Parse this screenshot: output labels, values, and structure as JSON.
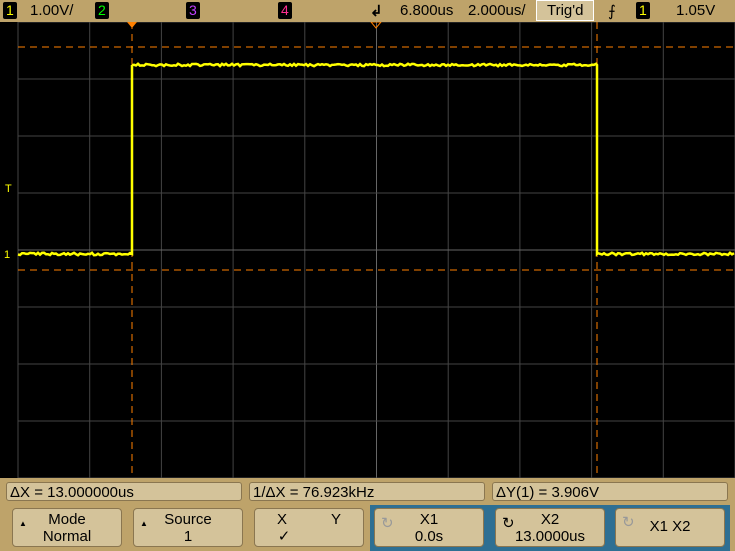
{
  "header": {
    "ch1": "1",
    "ch1_scale": "1.00V/",
    "ch2": "2",
    "ch3": "3",
    "ch4": "4",
    "time_delay": "6.800us",
    "time_scale": "2.000us/",
    "trigger_status": "Trig'd",
    "trigger_source": "1",
    "trigger_level": "1.05V"
  },
  "markers": {
    "trigger_marker": "T",
    "ch1_marker": "1"
  },
  "measurements": {
    "delta_x": "ΔX = 13.000000us",
    "inv_delta_x": "1/ΔX = 76.923kHz",
    "delta_y": "ΔY(1) = 3.906V"
  },
  "softkeys": [
    {
      "top": "Mode",
      "bottom": "Normal"
    },
    {
      "top": "Source",
      "bottom": "1"
    },
    {
      "top": "X",
      "top2": "Y",
      "bottom": "✓"
    },
    {
      "top": "X1",
      "bottom": "0.0s"
    },
    {
      "top": "X2",
      "bottom": "13.0000us"
    },
    {
      "top": "X1 X2"
    }
  ],
  "colors": {
    "ch1": "#ffff00",
    "ch2": "#00ff00",
    "ch3": "#c040ff",
    "ch4": "#ff3090",
    "cursor": "#ff8000",
    "panel": "#bea36a",
    "selected": "#2e6f93"
  }
}
